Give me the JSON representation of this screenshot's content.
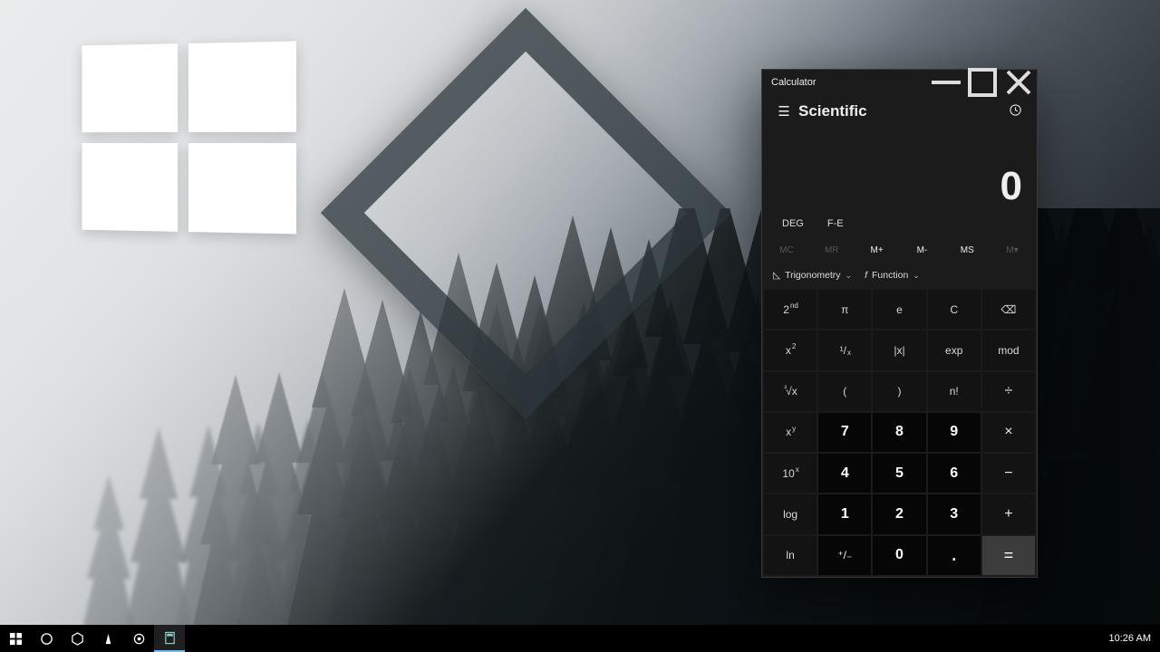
{
  "calc": {
    "title": "Calculator",
    "mode": "Scientific",
    "display": "0",
    "toggles": {
      "angle": "DEG",
      "notation": "F-E"
    },
    "memory": {
      "mc": "MC",
      "mr": "MR",
      "mplus": "M+",
      "mminus": "M-",
      "ms": "MS",
      "mlist": "M▾"
    },
    "dropdowns": {
      "trig": "Trigonometry",
      "func": "Function"
    },
    "keys": {
      "second": "2",
      "second_sup": "nd",
      "pi": "π",
      "e": "e",
      "clear": "C",
      "back": "⌫",
      "xsq": "x",
      "xsq_sup": "2",
      "recip_a": "¹",
      "recip_b": "/",
      "recip_c": "x",
      "abs": "|x|",
      "exp": "exp",
      "mod": "mod",
      "sqrt_a": "²",
      "sqrt_b": "√x",
      "lparen": "(",
      "rparen": ")",
      "fact": "n!",
      "div": "÷",
      "xy": "x",
      "xy_sup": "y",
      "n7": "7",
      "n8": "8",
      "n9": "9",
      "mul": "×",
      "tenx": "10",
      "tenx_sup": "x",
      "n4": "4",
      "n5": "5",
      "n6": "6",
      "sub": "−",
      "log": "log",
      "n1": "1",
      "n2": "2",
      "n3": "3",
      "add": "+",
      "ln": "ln",
      "negate": "⁺/₋",
      "n0": "0",
      "dot": ".",
      "eq": "="
    }
  },
  "taskbar": {
    "clock": "10:26 AM"
  }
}
